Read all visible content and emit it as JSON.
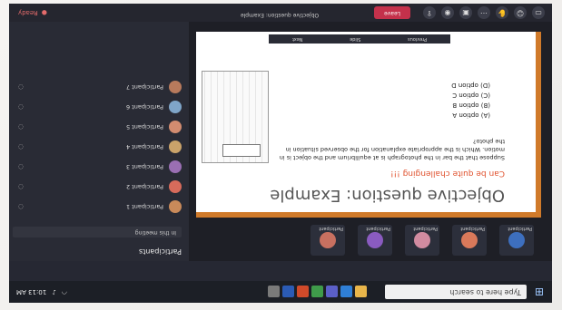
{
  "taskbar": {
    "search_placeholder": "Type here to search",
    "time": "10:13 AM",
    "apps": [
      {
        "icon": "file-explorer-icon",
        "color": "#e8b54a"
      },
      {
        "icon": "edge-icon",
        "color": "#2f7fd6"
      },
      {
        "icon": "teams-icon",
        "color": "#5b5fc7"
      },
      {
        "icon": "chrome-icon",
        "color": "#3f9b4a"
      },
      {
        "icon": "powerpoint-icon",
        "color": "#d04a2a"
      },
      {
        "icon": "word-icon",
        "color": "#2b5bb5"
      },
      {
        "icon": "settings-icon",
        "color": "#7a7a7a"
      }
    ]
  },
  "meeting": {
    "participant_tiles": [
      {
        "name": "Participant",
        "color": "#3d6fbf"
      },
      {
        "name": "Participant",
        "color": "#d9795a"
      },
      {
        "name": "Participant",
        "color": "#d18ba0"
      },
      {
        "name": "Participant",
        "color": "#8a5bc0"
      },
      {
        "name": "Participant",
        "color": "#c87060"
      }
    ],
    "title": "Objective question: Example",
    "pager": [
      "Previous",
      "Slide",
      "Next"
    ]
  },
  "slide": {
    "title": "Objective question: Example",
    "subtitle": "Can be quite challenging !!!",
    "question": "Suppose that the bar in the photograph is at equilibrium and the object is in motion. Which is the appropriate explanation for the observed situation in the photo?",
    "options": [
      "(A) option A",
      "(B) option B",
      "(C) option C",
      "(D) option D"
    ]
  },
  "sidebar": {
    "header": "Participants",
    "section": "In this meeting",
    "people": [
      {
        "name": "Participant 1",
        "color": "#c98a5a"
      },
      {
        "name": "Participant 2",
        "color": "#d76b5b"
      },
      {
        "name": "Participant 3",
        "color": "#9a6fb3"
      },
      {
        "name": "Participant 4",
        "color": "#caa36a"
      },
      {
        "name": "Participant 5",
        "color": "#d28c70"
      },
      {
        "name": "Participant 6",
        "color": "#7fa5c8"
      },
      {
        "name": "Participant 7",
        "color": "#b87a5c"
      }
    ]
  },
  "controls": {
    "leave_label": "Leave",
    "status": "Ready"
  },
  "colors": {
    "accent_orange": "#d07a2a",
    "leave_red": "#c4314b"
  }
}
